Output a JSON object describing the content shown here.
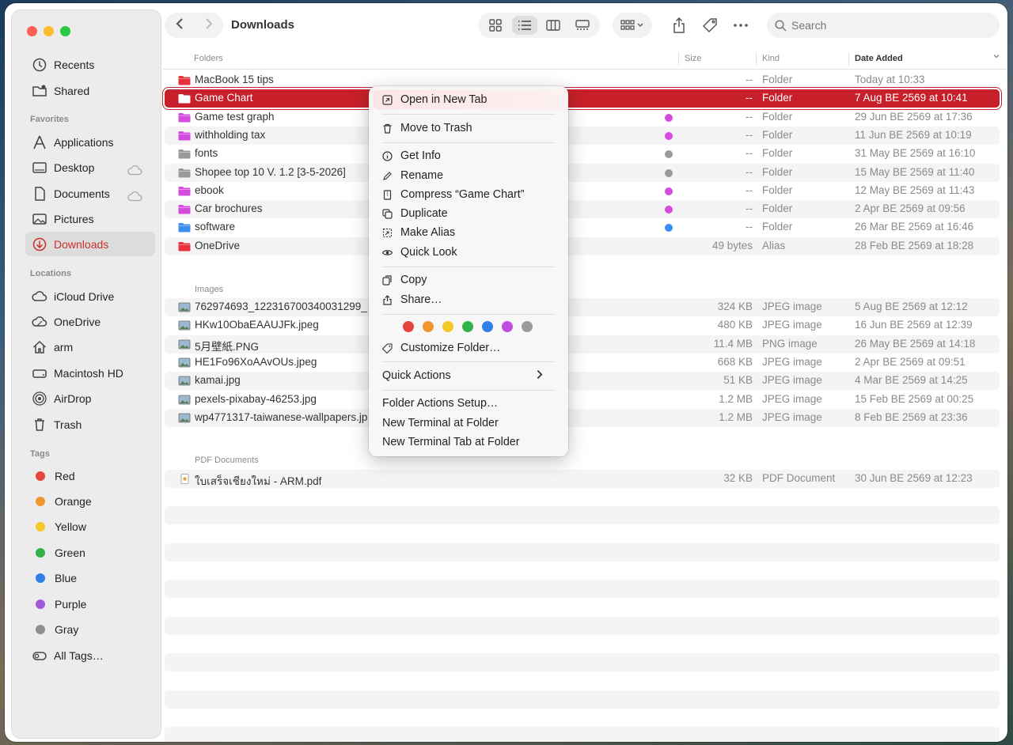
{
  "window": {
    "title": "Downloads"
  },
  "sidebar": {
    "items_top": [
      {
        "label": "Recents"
      },
      {
        "label": "Shared"
      }
    ],
    "favorites_heading": "Favorites",
    "favorites": [
      {
        "label": "Applications"
      },
      {
        "label": "Desktop"
      },
      {
        "label": "Documents"
      },
      {
        "label": "Pictures"
      },
      {
        "label": "Downloads"
      }
    ],
    "locations_heading": "Locations",
    "locations": [
      {
        "label": "iCloud Drive"
      },
      {
        "label": "OneDrive"
      },
      {
        "label": "arm"
      },
      {
        "label": "Macintosh HD"
      },
      {
        "label": "AirDrop"
      },
      {
        "label": "Trash"
      }
    ],
    "tags_heading": "Tags",
    "tags": [
      {
        "label": "Red",
        "color": "#e5453c"
      },
      {
        "label": "Orange",
        "color": "#f0962f"
      },
      {
        "label": "Yellow",
        "color": "#f5c928"
      },
      {
        "label": "Green",
        "color": "#33b24a"
      },
      {
        "label": "Blue",
        "color": "#2f7fe6"
      },
      {
        "label": "Purple",
        "color": "#a259d9"
      },
      {
        "label": "Gray",
        "color": "#8e8e93"
      }
    ],
    "all_tags": "All Tags…"
  },
  "toolbar": {
    "search_placeholder": "Search"
  },
  "columns": {
    "name": "Folders",
    "size": "Size",
    "kind": "Kind",
    "date": "Date Added"
  },
  "sections": {
    "images": "Images",
    "pdf": "PDF Documents"
  },
  "folders": [
    {
      "name": "MacBook 15 tips",
      "size": "--",
      "kind": "Folder",
      "date": "Today at 10:33",
      "tag": "",
      "icon": "#e8313a"
    },
    {
      "name": "Game Chart",
      "size": "--",
      "kind": "Folder",
      "date": "7 Aug BE 2569 at 10:41",
      "tag": "",
      "icon": "#e8313a"
    },
    {
      "name": "Game test graph",
      "size": "--",
      "kind": "Folder",
      "date": "29 Jun BE 2569 at 17:36",
      "tag": "#d44be0",
      "icon": "#d44be0"
    },
    {
      "name": "withholding tax",
      "size": "--",
      "kind": "Folder",
      "date": "11 Jun BE 2569 at 10:19",
      "tag": "#d44be0",
      "icon": "#d44be0"
    },
    {
      "name": "fonts",
      "size": "--",
      "kind": "Folder",
      "date": "31 May BE 2569 at 16:10",
      "tag": "#9a9a9a",
      "icon": "#9a9a9a"
    },
    {
      "name": "Shopee top 10 V. 1.2 [3-5-2026]",
      "size": "--",
      "kind": "Folder",
      "date": "15 May BE 2569 at 11:40",
      "tag": "#9a9a9a",
      "icon": "#9a9a9a"
    },
    {
      "name": "ebook",
      "size": "--",
      "kind": "Folder",
      "date": "12 May BE 2569 at 11:43",
      "tag": "#d44be0",
      "icon": "#d44be0"
    },
    {
      "name": "Car brochures",
      "size": "--",
      "kind": "Folder",
      "date": "2 Apr BE 2569 at 09:56",
      "tag": "#d44be0",
      "icon": "#d44be0"
    },
    {
      "name": "software",
      "size": "--",
      "kind": "Folder",
      "date": "26 Mar BE 2569 at 16:46",
      "tag": "#3b8ef0",
      "icon": "#3b8ef0"
    },
    {
      "name": "OneDrive",
      "size": "49 bytes",
      "kind": "Alias",
      "date": "28 Feb BE 2569 at 18:28",
      "tag": "",
      "icon": "#e8313a"
    }
  ],
  "images": [
    {
      "name": "762974693_122316700340031299_",
      "size": "324 KB",
      "kind": "JPEG image",
      "date": "5 Aug BE 2569 at 12:12"
    },
    {
      "name": "HKw10ObaEAAUJFk.jpeg",
      "size": "480 KB",
      "kind": "JPEG image",
      "date": "16 Jun BE 2569 at 12:39"
    },
    {
      "name": "5月壁紙.PNG",
      "size": "11.4 MB",
      "kind": "PNG image",
      "date": "26 May BE 2569 at 14:18"
    },
    {
      "name": "HE1Fo96XoAAvOUs.jpeg",
      "size": "668 KB",
      "kind": "JPEG image",
      "date": "2 Apr BE 2569 at 09:51"
    },
    {
      "name": "kamai.jpg",
      "size": "51 KB",
      "kind": "JPEG image",
      "date": "4 Mar BE 2569 at 14:25"
    },
    {
      "name": "pexels-pixabay-46253.jpg",
      "size": "1.2 MB",
      "kind": "JPEG image",
      "date": "15 Feb BE 2569 at 00:25"
    },
    {
      "name": "wp4771317-taiwanese-wallpapers.jp",
      "size": "1.2 MB",
      "kind": "JPEG image",
      "date": "8 Feb BE 2569 at 23:36"
    }
  ],
  "pdfs": [
    {
      "name": "ใบเสร็จเชียงใหม่ - ARM.pdf",
      "size": "32 KB",
      "kind": "PDF Document",
      "date": "30 Jun BE 2569 at 12:23"
    }
  ],
  "context_menu": {
    "open_new_tab": "Open in New Tab",
    "move_to_trash": "Move to Trash",
    "get_info": "Get Info",
    "rename": "Rename",
    "compress": "Compress “Game Chart”",
    "duplicate": "Duplicate",
    "make_alias": "Make Alias",
    "quick_look": "Quick Look",
    "copy": "Copy",
    "share": "Share…",
    "tag_colors": [
      "#e5453c",
      "#f0962f",
      "#f5c928",
      "#33b24a",
      "#2f7fe6",
      "#c14ee0",
      "#9a9a9a"
    ],
    "customize_folder": "Customize Folder…",
    "quick_actions": "Quick Actions",
    "folder_actions_setup": "Folder Actions Setup…",
    "new_terminal": "New Terminal at Folder",
    "new_terminal_tab": "New Terminal Tab at Folder"
  }
}
